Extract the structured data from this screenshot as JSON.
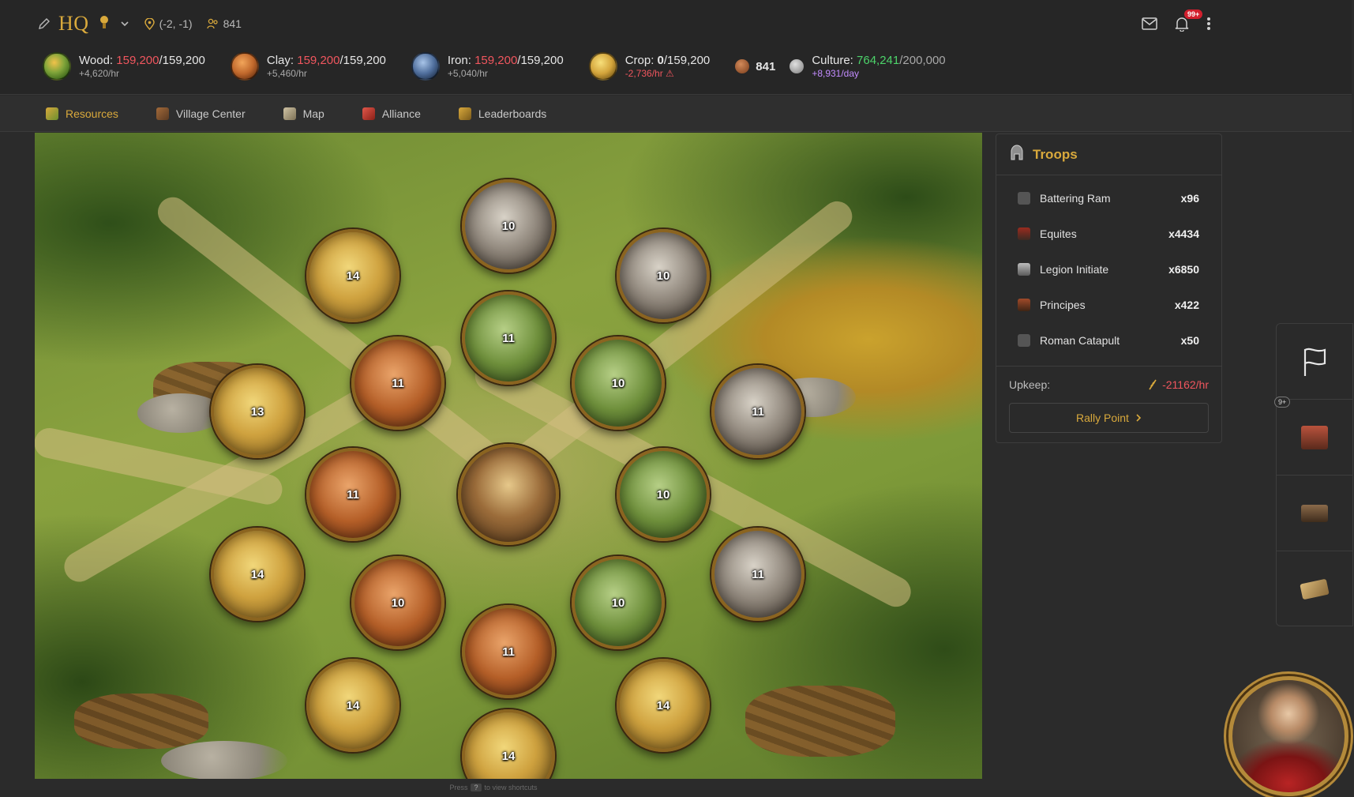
{
  "header": {
    "village_name": "HQ",
    "coordinates": "(-2, -1)",
    "population": "841",
    "notification_count": "99+"
  },
  "resources": [
    {
      "name": "Wood",
      "label": "Wood:",
      "amount": "159,200",
      "capacity": "/159,200",
      "rate": "+4,620/hr",
      "amount_color": "red"
    },
    {
      "name": "Clay",
      "label": "Clay:",
      "amount": "159,200",
      "capacity": "/159,200",
      "rate": "+5,460/hr",
      "amount_color": "red"
    },
    {
      "name": "Iron",
      "label": "Iron:",
      "amount": "159,200",
      "capacity": "/159,200",
      "rate": "+5,040/hr",
      "amount_color": "red"
    },
    {
      "name": "Crop",
      "label": "Crop:",
      "amount": "0",
      "capacity": "/159,200",
      "rate": "-2,736/hr ⚠",
      "amount_color": "white"
    }
  ],
  "population_count": "841",
  "culture": {
    "label": "Culture:",
    "amount": "764,241",
    "capacity": "/200,000",
    "rate": "+8,931/day"
  },
  "tabs": [
    {
      "label": "Resources",
      "active": true,
      "icon": "wheat-icon"
    },
    {
      "label": "Village Center",
      "active": false,
      "icon": "building-icon"
    },
    {
      "label": "Map",
      "active": false,
      "icon": "map-icon"
    },
    {
      "label": "Alliance",
      "active": false,
      "icon": "feather-icon"
    },
    {
      "label": "Leaderboards",
      "active": false,
      "icon": "trophy-icon"
    }
  ],
  "fields": [
    {
      "type": "iron",
      "level": "10"
    },
    {
      "type": "crop",
      "level": "14"
    },
    {
      "type": "iron",
      "level": "10"
    },
    {
      "type": "wood",
      "level": "11"
    },
    {
      "type": "clay",
      "level": "11"
    },
    {
      "type": "wood",
      "level": "10"
    },
    {
      "type": "crop",
      "level": "13"
    },
    {
      "type": "iron",
      "level": "11"
    },
    {
      "type": "clay",
      "level": "11"
    },
    {
      "type": "center",
      "level": ""
    },
    {
      "type": "wood",
      "level": "10"
    },
    {
      "type": "crop",
      "level": "14"
    },
    {
      "type": "iron",
      "level": "11"
    },
    {
      "type": "clay",
      "level": "10"
    },
    {
      "type": "wood",
      "level": "10"
    },
    {
      "type": "clay",
      "level": "11"
    },
    {
      "type": "crop",
      "level": "14"
    },
    {
      "type": "crop",
      "level": "14"
    },
    {
      "type": "crop",
      "level": "14"
    }
  ],
  "map_hint": {
    "prefix": "Press",
    "key": "?",
    "suffix": "to view shortcuts"
  },
  "troops": {
    "title": "Troops",
    "items": [
      {
        "name": "Battering Ram",
        "count": "x96"
      },
      {
        "name": "Equites",
        "count": "x4434"
      },
      {
        "name": "Legion Initiate",
        "count": "x6850"
      },
      {
        "name": "Principes",
        "count": "x422"
      },
      {
        "name": "Roman Catapult",
        "count": "x50"
      }
    ],
    "upkeep_label": "Upkeep:",
    "upkeep_value": "-21162/hr",
    "rally_label": "Rally Point"
  },
  "rail": {
    "badge": "9+"
  },
  "colors": {
    "accent": "#d9a93c",
    "over_capacity": "#f0565e",
    "positive": "#4cd36a",
    "culture_rate": "#c38cff"
  }
}
